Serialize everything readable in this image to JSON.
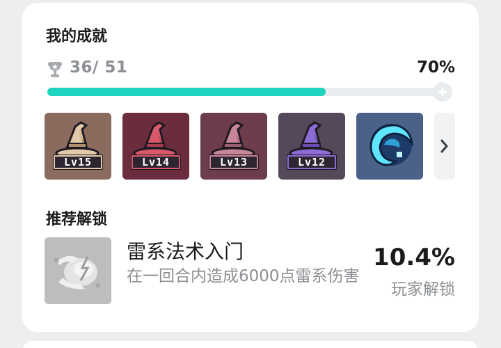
{
  "achievements": {
    "title": "我的成就",
    "unlocked_count": "36/ 51",
    "percent_label": "70%",
    "progress": 0.7,
    "icons": {
      "trophy": "trophy-icon",
      "goal": "sparkle-icon",
      "more": "chevron-right-icon"
    },
    "badges": [
      {
        "name": "wizard-hat",
        "level": "Lv15",
        "bg": "#8b6b5e",
        "hat": "#e2c9a8",
        "shade": "#b08f6f"
      },
      {
        "name": "wizard-hat",
        "level": "Lv14",
        "bg": "#6b2d3d",
        "hat": "#d85a6a",
        "shade": "#a63c4e"
      },
      {
        "name": "wizard-hat",
        "level": "Lv13",
        "bg": "#6e3d4c",
        "hat": "#c9859a",
        "shade": "#9a5c71"
      },
      {
        "name": "wizard-hat",
        "level": "Lv12",
        "bg": "#54495a",
        "hat": "#8d6bd6",
        "shade": "#6a4fb0"
      },
      {
        "name": "crystal-orb",
        "level": "",
        "bg": "#4b6288",
        "hat": "#5fe6ff",
        "shade": "#2ea0d8"
      }
    ]
  },
  "recommended": {
    "section_title": "推荐解锁",
    "name": "雷系法术入门",
    "description": "在一回合内造成6000点雷系伤害",
    "rate": "10.4%",
    "rate_label": "玩家解锁",
    "icon": "thunder-orb-icon"
  },
  "colors": {
    "accent": "#1fd3c1",
    "muted": "#8c8f93",
    "text": "#1b1b1b"
  }
}
